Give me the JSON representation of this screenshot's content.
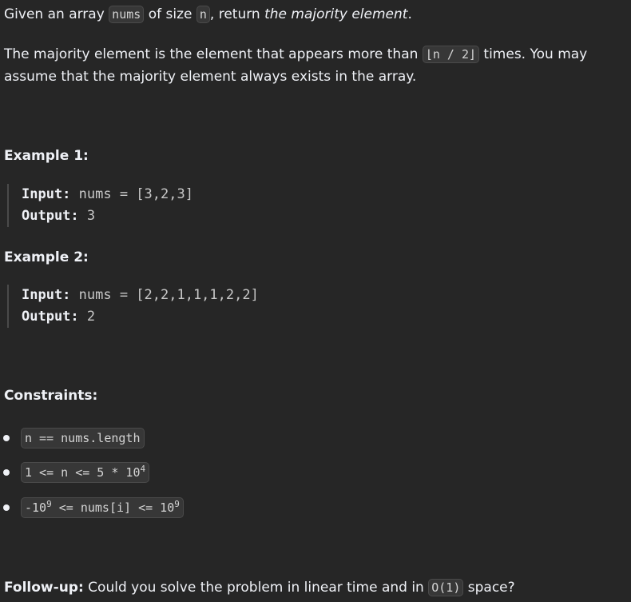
{
  "description": {
    "p1": {
      "pre": "Given an array ",
      "code1": "nums",
      "mid": " of size ",
      "code2": "n",
      "post": ", return ",
      "em": "the majority element",
      "end": "."
    },
    "p2": {
      "pre": "The majority element is the element that appears more than ",
      "code": "⌊n / 2⌋",
      "post": " times. You may assume that the majority element always exists in the array."
    }
  },
  "examples": [
    {
      "title": "Example 1:",
      "input_label": "Input:",
      "input_value": " nums = [3,2,3]",
      "output_label": "Output:",
      "output_value": " 3"
    },
    {
      "title": "Example 2:",
      "input_label": "Input:",
      "input_value": " nums = [2,2,1,1,1,2,2]",
      "output_label": "Output:",
      "output_value": " 2"
    }
  ],
  "constraints": {
    "title": "Constraints:",
    "c1": "n == nums.length",
    "c2_base": "1 <= n <= 5 * 10",
    "c2_exp": "4",
    "c3_a": "-10",
    "c3_a_exp": "9",
    "c3_mid": " <= nums[i] <= 10",
    "c3_b_exp": "9"
  },
  "follow_up": {
    "label": "Follow-up:",
    "pre": " Could you solve the problem in linear time and in ",
    "code": "O(1)",
    "post": " space?"
  }
}
